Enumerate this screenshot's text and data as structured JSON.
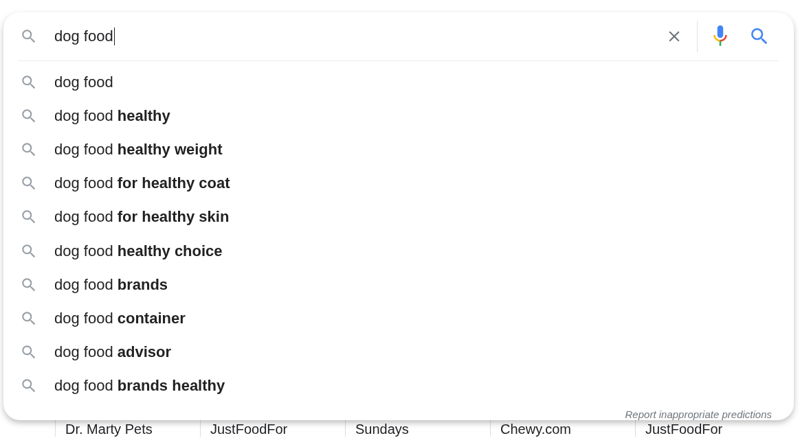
{
  "search_box": {
    "value": "dog food"
  },
  "suggestions": [
    {
      "text": "dog food"
    },
    {
      "text": "dog food **healthy**"
    },
    {
      "text": "dog food **healthy weight**"
    },
    {
      "text": "dog food **for healthy coat**"
    },
    {
      "text": "dog food **for healthy skin**"
    },
    {
      "text": "dog food **healthy choice**"
    },
    {
      "text": "dog food **brands**"
    },
    {
      "text": "dog food **container**"
    },
    {
      "text": "dog food **advisor**"
    },
    {
      "text": "dog food **brands healthy**"
    }
  ],
  "report_link": "Report inappropriate predictions",
  "results_chips": [
    "Dr. Marty Pets",
    "JustFoodFor",
    "Sundays",
    "Chewy.com",
    "JustFoodFor"
  ]
}
